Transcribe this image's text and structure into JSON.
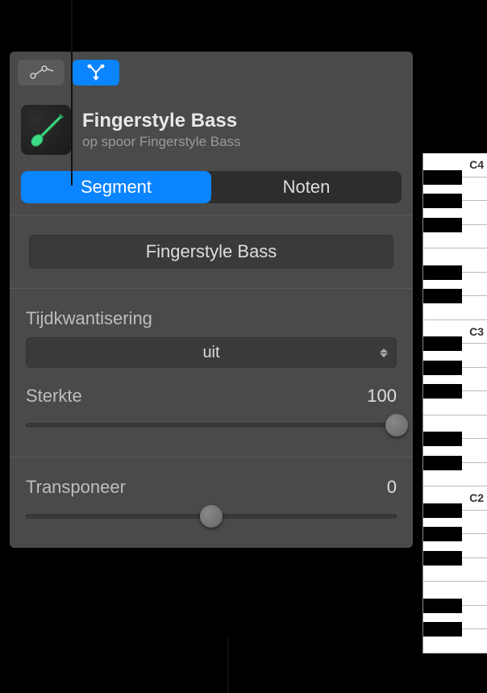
{
  "region": {
    "title": "Fingerstyle Bass",
    "subtitle": "op spoor Fingerstyle Bass"
  },
  "tabs": {
    "segment": "Segment",
    "notes": "Noten"
  },
  "region_name": "Fingerstyle Bass",
  "quantize": {
    "label": "Tijdkwantisering",
    "value": "uit"
  },
  "strength": {
    "label": "Sterkte",
    "value": "100",
    "percent": 100
  },
  "transpose": {
    "label": "Transponeer",
    "value": "0",
    "percent": 50
  },
  "piano": {
    "labels": [
      "C4",
      "C3",
      "C2"
    ]
  }
}
